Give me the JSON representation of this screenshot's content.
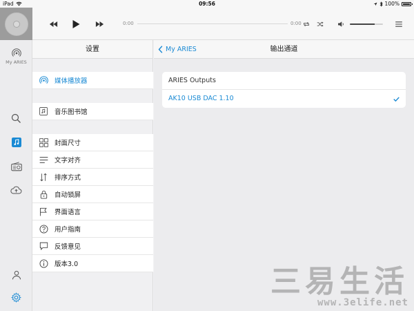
{
  "statusbar": {
    "device": "iPad",
    "time": "09:56",
    "battery": "100%"
  },
  "player": {
    "elapsed": "0:00",
    "remaining": "0:00",
    "volume_level": 0.75
  },
  "rail": {
    "device_label": "My ARIES"
  },
  "settings": {
    "title": "设置",
    "items": [
      {
        "label": "媒体播放器",
        "icon": "speaker-wifi-icon",
        "active": true
      },
      {
        "label": "音乐图书馆",
        "icon": "music-library-icon"
      },
      {
        "label": "封面尺寸",
        "icon": "grid-icon"
      },
      {
        "label": "文字对齐",
        "icon": "text-align-icon"
      },
      {
        "label": "排序方式",
        "icon": "sort-icon"
      },
      {
        "label": "自动锁屏",
        "icon": "lock-icon"
      },
      {
        "label": "界面语言",
        "icon": "flag-icon"
      },
      {
        "label": "用户指南",
        "icon": "help-icon"
      },
      {
        "label": "反馈意见",
        "icon": "chat-icon"
      },
      {
        "label": "版本3.0",
        "icon": "info-icon"
      }
    ]
  },
  "output": {
    "back_label": "My ARIES",
    "title": "输出通道",
    "group_label": "ARIES Outputs",
    "selected_output": "AK10 USB DAC 1.10"
  },
  "watermark": {
    "text": "三易生活",
    "url": "www.3elife.net"
  },
  "colors": {
    "accent": "#1a8ad4",
    "rail_bg": "#ececee",
    "panel_bg": "#f0f0f2"
  }
}
